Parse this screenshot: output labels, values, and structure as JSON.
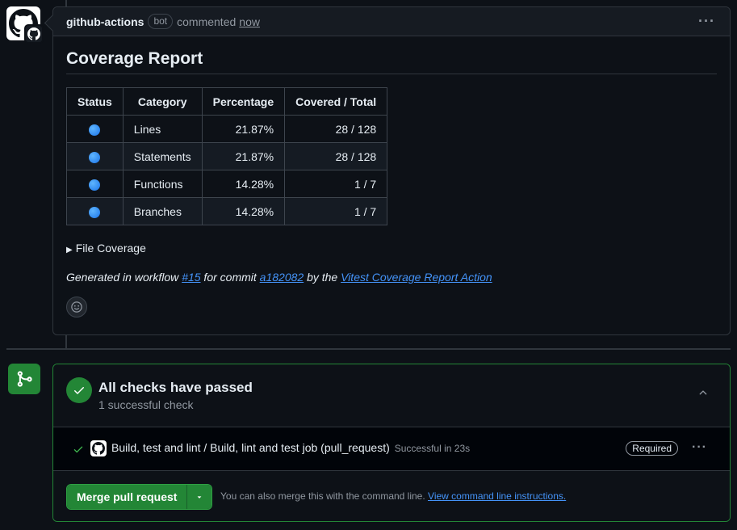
{
  "comment": {
    "author": "github-actions",
    "badge": "bot",
    "action": "commented",
    "time": "now",
    "title": "Coverage Report",
    "table": {
      "headers": [
        "Status",
        "Category",
        "Percentage",
        "Covered / Total"
      ],
      "rows": [
        {
          "status": "blue-circle-icon",
          "category": "Lines",
          "percentage": "21.87%",
          "covered": "28 / 128"
        },
        {
          "status": "blue-circle-icon",
          "category": "Statements",
          "percentage": "21.87%",
          "covered": "28 / 128"
        },
        {
          "status": "blue-circle-icon",
          "category": "Functions",
          "percentage": "14.28%",
          "covered": "1 / 7"
        },
        {
          "status": "blue-circle-icon",
          "category": "Branches",
          "percentage": "14.28%",
          "covered": "1 / 7"
        }
      ]
    },
    "details_summary": "File Coverage",
    "generated": {
      "prefix": "Generated in workflow ",
      "workflow_link": "#15",
      "mid": " for commit ",
      "commit_link": "a182082",
      "by": " by the ",
      "action_link": "Vitest Coverage Report Action"
    }
  },
  "checks": {
    "title": "All checks have passed",
    "subtitle": "1 successful check",
    "job": {
      "name": "Build, test and lint / Build, lint and test job (pull_request)",
      "status": "Successful in 23s",
      "badge": "Required"
    }
  },
  "merge": {
    "button_label": "Merge pull request",
    "note": "You can also merge this with the command line. ",
    "note_link": "View command line instructions."
  },
  "colors": {
    "background": "#0d1117",
    "success": "#238636",
    "link": "#4493f8",
    "border": "#30363d"
  }
}
